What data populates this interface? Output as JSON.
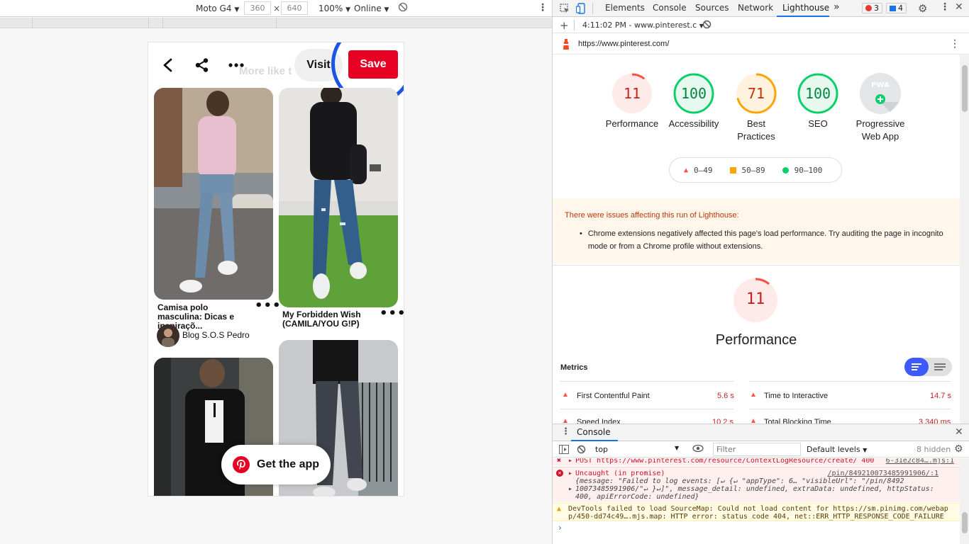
{
  "device_toolbar": {
    "device": "Moto G4",
    "width": "360",
    "height": "640",
    "times": "×",
    "zoom": "100%",
    "network": "Online"
  },
  "phone": {
    "visit_label": "Visit",
    "save_label": "Save",
    "ghost_heading": "More like t",
    "get_app_label": "Get the app",
    "pins": [
      {
        "title": "Camisa polo masculina: Dicas e inspiraçõ...",
        "author": "Blog S.O.S Pedro"
      },
      {
        "title": "My Forbidden Wish (CAMILA/YOU G!P)"
      }
    ]
  },
  "devtools": {
    "tabs": [
      "Elements",
      "Console",
      "Sources",
      "Network",
      "Lighthouse"
    ],
    "active_tab": "Lighthouse",
    "more_tabs": "»",
    "error_count": "3",
    "info_count": "4",
    "lighthouse_bar": {
      "plus": "+",
      "run_label": "4:11:02 PM - www.pinterest.c"
    },
    "report_url": "https://www.pinterest.com/",
    "scores": [
      {
        "label": "Performance",
        "value": "11",
        "color": "#ff4e42"
      },
      {
        "label": "Accessibility",
        "value": "100",
        "color": "#0cce6b"
      },
      {
        "label": "Best Practices",
        "value": "71",
        "color": "#ffa400"
      },
      {
        "label": "SEO",
        "value": "100",
        "color": "#0cce6b"
      }
    ],
    "pwa_label": "Progressive Web App",
    "pwa_badge": "PWA",
    "legend": [
      {
        "range": "0–49",
        "color": "#ff4e42"
      },
      {
        "range": "50–89",
        "color": "#ffa400"
      },
      {
        "range": "90–100",
        "color": "#0cce6b"
      }
    ],
    "warning": {
      "title": "There were issues affecting this run of Lighthouse:",
      "item": "Chrome extensions negatively affected this page's load performance. Try auditing the page in incognito mode or from a Chrome profile without extensions."
    },
    "perf_section": {
      "score": "11",
      "title": "Performance",
      "metrics_label": "Metrics",
      "metrics": [
        {
          "name": "First Contentful Paint",
          "value": "5.6 s"
        },
        {
          "name": "Time to Interactive",
          "value": "14.7 s"
        },
        {
          "name": "Speed Index",
          "value": "10.2 s"
        },
        {
          "name": "Total Blocking Time",
          "value": "3,340 ms"
        }
      ]
    }
  },
  "console": {
    "tab_label": "Console",
    "context": "top",
    "filter_placeholder": "Filter",
    "levels": "Default levels",
    "hidden": "8 hidden",
    "messages": {
      "post_line": "POST https://www.pinterest.com/resource/ContextLogResource/create/ 400",
      "post_source": "6-31e2c84….mjs:1",
      "uncaught": "Uncaught (in promise)",
      "uncaught_source": "/pin/849210073485991906/:1",
      "uncaught_l1": "{message: \"Failed to log events: [↵    {↵        \"appType\": 6… \"visibleUrl\": \"/pin/8492",
      "uncaught_l2": "10073485991906/\"↵    }↵]\", message_detail: undefined, extraData: undefined, httpStatus:",
      "uncaught_l3": "400, apiErrorCode: undefined}",
      "warn_l1": "DevTools failed to load SourceMap: Could not load content for https://sm.pinimg.com/webap",
      "warn_l2": "p/450-dd74c49….mjs.map: HTTP error: status code 404, net::ERR_HTTP_RESPONSE_CODE_FAILURE",
      "prompt": "›"
    }
  }
}
